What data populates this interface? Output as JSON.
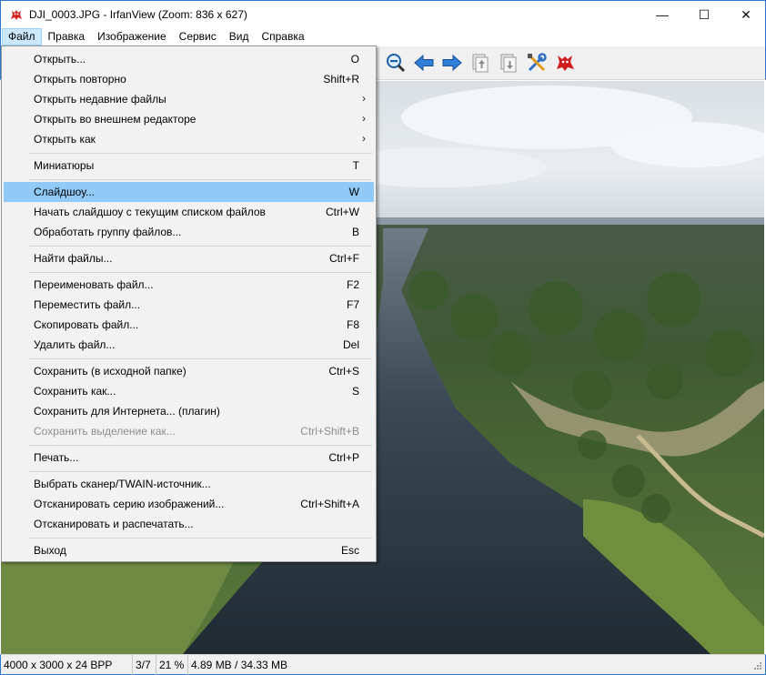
{
  "window": {
    "title": "DJI_0003.JPG - IrfanView (Zoom: 836 x 627)",
    "minimize_glyph": "—",
    "maximize_glyph": "☐",
    "close_glyph": "✕"
  },
  "menubar": {
    "items": [
      "Файл",
      "Правка",
      "Изображение",
      "Сервис",
      "Вид",
      "Справка"
    ],
    "active_index": 0
  },
  "toolbar": {
    "icons": [
      "zoom-out-icon",
      "previous-arrow-icon",
      "next-arrow-icon",
      "copy-to-clipboard-icon",
      "paste-icon",
      "settings-tools-icon",
      "irfanview-cat-icon"
    ]
  },
  "file_menu": {
    "items": [
      {
        "label": "Открыть...",
        "shortcut": "O"
      },
      {
        "label": "Открыть повторно",
        "shortcut": "Shift+R"
      },
      {
        "label": "Открыть недавние файлы",
        "shortcut": "",
        "submenu": true
      },
      {
        "label": "Открыть во внешнем редакторе",
        "shortcut": "",
        "submenu": true
      },
      {
        "label": "Открыть как",
        "shortcut": "",
        "submenu": true
      },
      {
        "separator": true
      },
      {
        "label": "Миниатюры",
        "shortcut": "T"
      },
      {
        "separator": true
      },
      {
        "label": "Слайдшоу...",
        "shortcut": "W",
        "highlighted": true
      },
      {
        "label": "Начать слайдшоу с текущим списком файлов",
        "shortcut": "Ctrl+W"
      },
      {
        "label": "Обработать группу файлов...",
        "shortcut": "B"
      },
      {
        "separator": true
      },
      {
        "label": "Найти файлы...",
        "shortcut": "Ctrl+F"
      },
      {
        "separator": true
      },
      {
        "label": "Переименовать файл...",
        "shortcut": "F2"
      },
      {
        "label": "Переместить файл...",
        "shortcut": "F7"
      },
      {
        "label": "Скопировать файл...",
        "shortcut": "F8"
      },
      {
        "label": "Удалить файл...",
        "shortcut": "Del"
      },
      {
        "separator": true
      },
      {
        "label": "Сохранить (в исходной папке)",
        "shortcut": "Ctrl+S"
      },
      {
        "label": "Сохранить как...",
        "shortcut": "S"
      },
      {
        "label": "Сохранить для Интернета... (плагин)",
        "shortcut": ""
      },
      {
        "label": "Сохранить выделение как...",
        "shortcut": "Ctrl+Shift+B",
        "disabled": true
      },
      {
        "separator": true
      },
      {
        "label": "Печать...",
        "shortcut": "Ctrl+P"
      },
      {
        "separator": true
      },
      {
        "label": "Выбрать сканер/TWAIN-источник...",
        "shortcut": ""
      },
      {
        "label": "Отсканировать серию изображений...",
        "shortcut": "Ctrl+Shift+A"
      },
      {
        "label": "Отсканировать и распечатать...",
        "shortcut": ""
      },
      {
        "separator": true
      },
      {
        "label": "Выход",
        "shortcut": "Esc"
      }
    ],
    "submenu_glyph": "›"
  },
  "statusbar": {
    "dimensions": "4000 x 3000 x 24 BPP",
    "position": "3/7",
    "zoom": "21 %",
    "size": "4.89 MB / 34.33 MB"
  },
  "colors": {
    "menu_highlight": "#91c9f7",
    "menubar_active": "#cce8ff",
    "window_border": "#2b79d0"
  }
}
